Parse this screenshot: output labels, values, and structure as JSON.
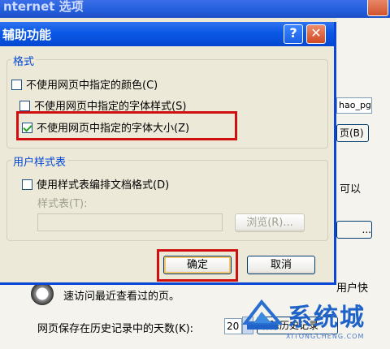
{
  "background_window": {
    "title": "nternet 选项",
    "username_value": "hao_pg",
    "page_button": "页(B)",
    "side_text": "以",
    "side_text2": "可",
    "ellipsis_button": "...",
    "history_text": "速访问最近查看过的页。",
    "history_text_right": "用户快",
    "days_label": "网页保存在历史记录中的天数(K):",
    "days_value": "20",
    "clear_history_button": "清除历史记录"
  },
  "dialog": {
    "title": "辅助功能",
    "help_button": "?",
    "close_button": "✕",
    "format_group": {
      "label": "格式",
      "options": [
        {
          "label": "不使用网页中指定的颜色(C)",
          "checked": false
        },
        {
          "label": "不使用网页中指定的字体样式(S)",
          "checked": false
        },
        {
          "label": "不使用网页中指定的字体大小(Z)",
          "checked": true
        }
      ]
    },
    "user_stylesheet_group": {
      "label": "用户样式表",
      "option": {
        "label": "使用样式表编排文档格式(D)",
        "checked": false
      },
      "stylesheet_label": "样式表(T):",
      "stylesheet_value": "",
      "browse_button": "浏览(R)..."
    },
    "ok_button": "确定",
    "cancel_button": "取消"
  },
  "watermark": {
    "text": "系统城",
    "sub": "XITONGCHENG.COM"
  },
  "colors": {
    "title_bar": "#0a58e6",
    "highlight": "#d01010",
    "group_label": "#0046d5"
  }
}
